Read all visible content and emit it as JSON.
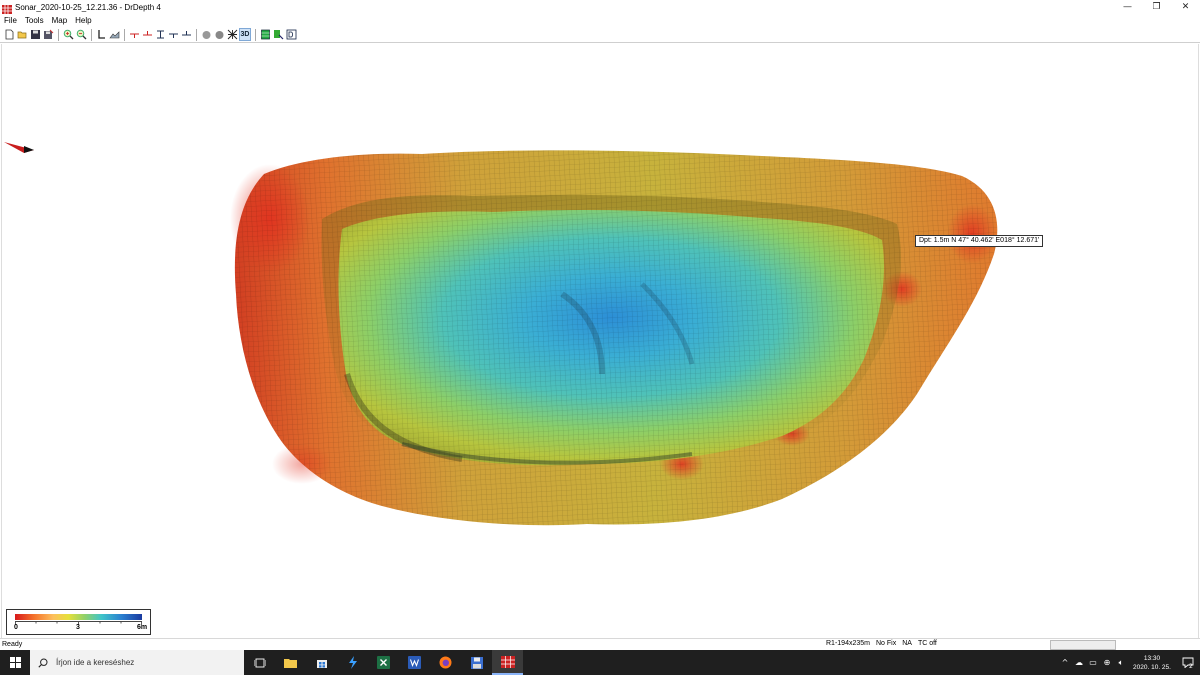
{
  "window": {
    "title": "Sonar_2020-10-25_12.21.36 - DrDepth 4",
    "minimize_glyph": "—",
    "restore_glyph": "❐",
    "close_glyph": "✕"
  },
  "menu": {
    "items": [
      {
        "label": "File"
      },
      {
        "label": "Tools"
      },
      {
        "label": "Map"
      },
      {
        "label": "Help"
      }
    ]
  },
  "toolbar": {
    "buttons": [
      "new-icon",
      "open-icon",
      "save-icon",
      "save-as-icon",
      "zoom-in-icon",
      "zoom-out-icon",
      "corner-icon",
      "profile-icon",
      "track-red-icon",
      "track-red-icon",
      "track-icon",
      "track-icon",
      "track-icon",
      "sphere-icon",
      "sphere-icon",
      "crosshair-icon",
      "3d-icon",
      "grid-icon",
      "export-icon",
      "database-icon"
    ],
    "label_3d": "3D"
  },
  "map": {
    "tooltip": "Dpt: 1.5m N 47° 40.462' E018° 12.671'",
    "legend": {
      "min_label": "0",
      "mid_label": "3",
      "max_label": "6m",
      "colors": [
        "#d7191c",
        "#f4722b",
        "#fdbf5c",
        "#e6e03a",
        "#8fd16a",
        "#3fc5c9",
        "#2a7fd0",
        "#1a3aa0"
      ]
    }
  },
  "status": {
    "ready": "Ready",
    "grid": "R1-194x235m",
    "fix": "No Fix",
    "na": "NA",
    "tc": "TC off"
  },
  "taskbar": {
    "search_placeholder": "Írjon ide a kereséshez",
    "clock_time": "13:30",
    "clock_date": "2020. 10. 25.",
    "notification_count": "2"
  }
}
